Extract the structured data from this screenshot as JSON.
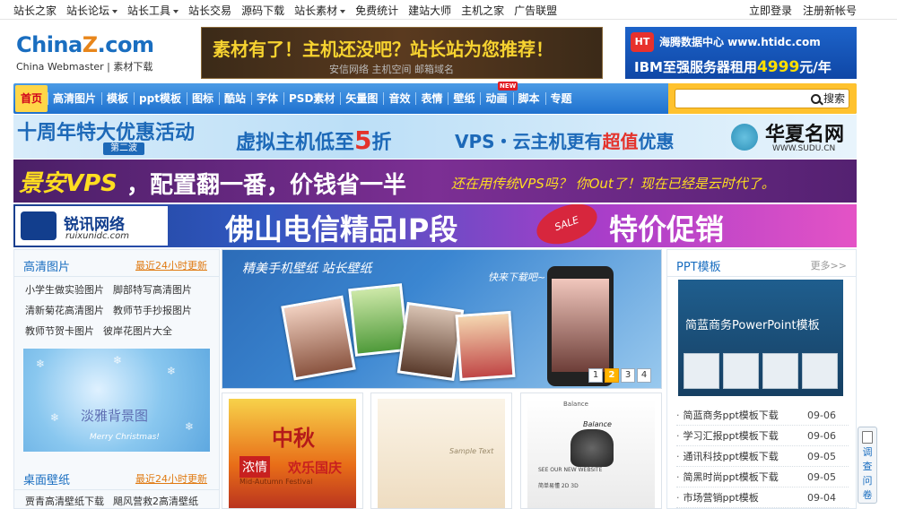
{
  "top_nav": [
    {
      "label": "站长之家",
      "dropdown": false
    },
    {
      "label": "站长论坛",
      "dropdown": true
    },
    {
      "label": "站长工具",
      "dropdown": true
    },
    {
      "label": "站长交易",
      "dropdown": false
    },
    {
      "label": "源码下载",
      "dropdown": false
    },
    {
      "label": "站长素材",
      "dropdown": true
    },
    {
      "label": "免费统计",
      "dropdown": false
    },
    {
      "label": "建站大师",
      "dropdown": false
    },
    {
      "label": "主机之家",
      "dropdown": false
    },
    {
      "label": "广告联盟",
      "dropdown": false
    }
  ],
  "top_links": {
    "login": "立即登录",
    "register": "注册新帐号"
  },
  "logo": {
    "brand_a": "China",
    "brand_z": "Z",
    "brand_b": ".com",
    "sub": "China Webmaster  |  素材下载"
  },
  "header_ads": {
    "left_title": "素材有了！主机还没吧？站长站为您推荐！",
    "left_sub": "安信网络 主机空间 邮箱域名",
    "right_logo": "HT",
    "right_title": "海腾数据中心 www.htidc.com",
    "right_text": "IBM至强服务器租用",
    "right_price": "4999",
    "right_unit": "元/年"
  },
  "main_nav": [
    "首页",
    "高清图片",
    "模板",
    "ppt模板",
    "图标",
    "酷站",
    "字体",
    "PSD素材",
    "矢量图",
    "音效",
    "表情",
    "壁纸",
    "动画",
    "脚本",
    "专题"
  ],
  "nav_badge": "NEW",
  "search": {
    "placeholder": "",
    "button": "搜索"
  },
  "ad1": {
    "a": "十周年特大优惠活动",
    "b": "第二波",
    "c1": "虚拟主机低至",
    "c2": "5",
    "c3": "折",
    "d1": "VPS・云主机更有",
    "d2": "超值",
    "d3": "优惠",
    "e": "华夏名网",
    "f": "WWW.SUDU.CN"
  },
  "ad2": {
    "a": "景安VPS",
    "b": "，配置翻一番，价钱省一半",
    "c": "还在用传统VPS吗？ 你Out了！现在已经是云时代了。"
  },
  "ad3": {
    "t1": "锐讯网络",
    "t2": "ruixunidc.com",
    "b": "佛山电信精品IP段",
    "sale": "SALE",
    "c": "特价促销"
  },
  "hd_images": {
    "title": "高清图片",
    "more": "最近24小时更新",
    "links": [
      [
        "小学生做实验图片",
        "脚部特写高清图片"
      ],
      [
        "清新菊花高清图片",
        "教师节手抄报图片"
      ],
      [
        "教师节贺卡图片",
        "彼岸花图片大全"
      ]
    ],
    "thumb_title": "淡雅背景图",
    "thumb_sub": "Merry Christmas!"
  },
  "wallpaper": {
    "title": "桌面壁纸",
    "more": "最近24小时更新",
    "links": [
      [
        "贾青高清壁纸下载",
        "飓风营救2高清壁纸"
      ]
    ]
  },
  "slider": {
    "title": "精美手机壁纸  站长壁纸",
    "caption": "快来下载吧~",
    "pages": [
      "1",
      "2",
      "3",
      "4"
    ],
    "active_page": 2
  },
  "tiles": {
    "t1": {
      "a": "中秋",
      "b": "浓情",
      "c": "Mid-Autumn Festival",
      "d": "欢乐国庆"
    },
    "t2": {
      "a": "Sample Text"
    },
    "t3": {
      "a": "Balance",
      "b": "Balance",
      "c": "SEE OUR NEW WEBSITE",
      "d": "简单易懂 2D 3D"
    }
  },
  "ppt": {
    "title": "PPT模板",
    "more": "更多>>",
    "thumb_title": "简蓝商务PowerPoint模板",
    "items": [
      {
        "name": "简蓝商务ppt模板下载",
        "date": "09-06"
      },
      {
        "name": "学习汇报ppt模板下载",
        "date": "09-06"
      },
      {
        "name": "通讯科技ppt模板下载",
        "date": "09-05"
      },
      {
        "name": "简黑时尚ppt模板下载",
        "date": "09-05"
      },
      {
        "name": "市场营销ppt模板",
        "date": "09-04"
      }
    ]
  },
  "survey": {
    "text": "调查问卷"
  }
}
